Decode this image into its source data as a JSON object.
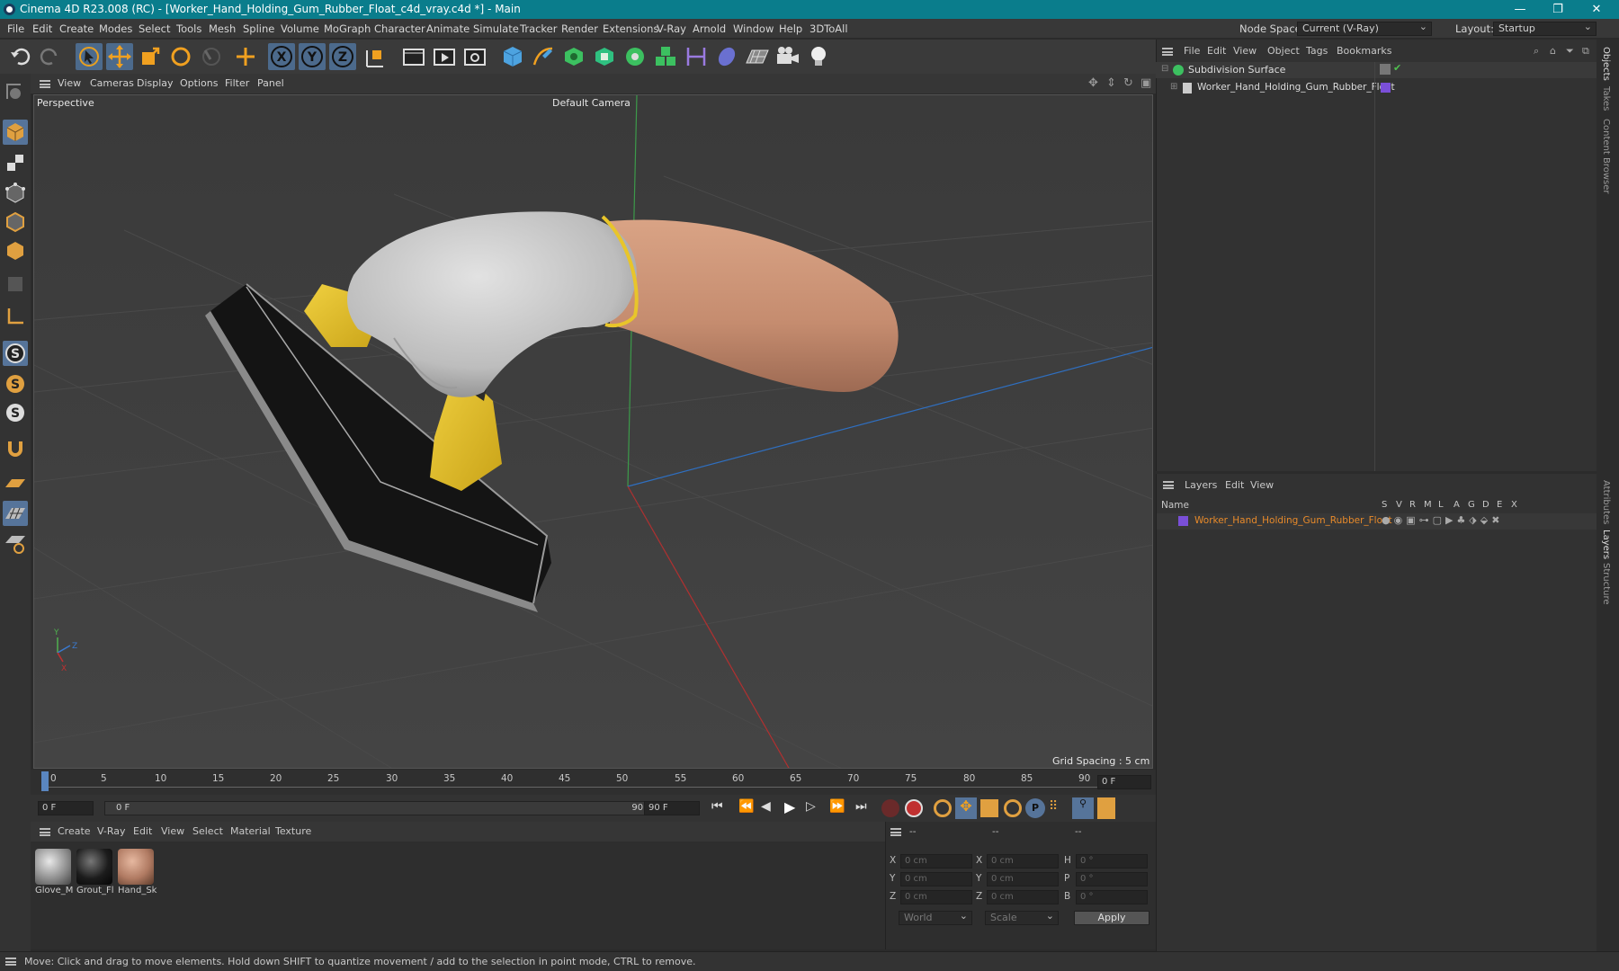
{
  "title": "Cinema 4D R23.008 (RC) - [Worker_Hand_Holding_Gum_Rubber_Float_c4d_vray.c4d *] - Main",
  "window_controls": {
    "minimize": "—",
    "restore": "❐",
    "close": "✕"
  },
  "menu": [
    "File",
    "Edit",
    "Create",
    "Modes",
    "Select",
    "Tools",
    "Mesh",
    "Spline",
    "Volume",
    "MoGraph",
    "Character",
    "Animate",
    "Simulate",
    "Tracker",
    "Render",
    "Extensions",
    "V-Ray",
    "Arnold",
    "Window",
    "Help",
    "3DToAll"
  ],
  "node_space": {
    "label": "Node Space:",
    "value": "Current (V-Ray)"
  },
  "layout": {
    "label": "Layout:",
    "value": "Startup"
  },
  "viewport": {
    "menu": [
      "View",
      "Cameras",
      "Display",
      "Options",
      "Filter",
      "Panel"
    ],
    "label": "Perspective",
    "camera": "Default Camera",
    "grid_spacing": "Grid Spacing : 5 cm",
    "axis": {
      "y": "Y",
      "z": "Z",
      "x": "X"
    }
  },
  "timeline": {
    "ticks": [
      "0",
      "5",
      "10",
      "15",
      "20",
      "25",
      "30",
      "35",
      "40",
      "45",
      "50",
      "55",
      "60",
      "65",
      "70",
      "75",
      "80",
      "85",
      "90"
    ],
    "current_frame": "0 F",
    "start": "0 F",
    "range_start": "0 F",
    "range_end": "90 F",
    "end": "90 F"
  },
  "materials": {
    "menu": [
      "Create",
      "V-Ray",
      "Edit",
      "View",
      "Select",
      "Material",
      "Texture"
    ],
    "items": [
      {
        "label": "Glove_M",
        "color": "#b9b9b9"
      },
      {
        "label": "Grout_Fl",
        "color": "#1c1c1c"
      },
      {
        "label": "Hand_Sk",
        "color": "#b07a62"
      }
    ]
  },
  "coordinates": {
    "headers": [
      "--",
      "--",
      "--"
    ],
    "rows": [
      {
        "l1": "X",
        "v1": "0 cm",
        "l2": "X",
        "v2": "0 cm",
        "l3": "H",
        "v3": "0 °"
      },
      {
        "l1": "Y",
        "v1": "0 cm",
        "l2": "Y",
        "v2": "0 cm",
        "l3": "P",
        "v3": "0 °"
      },
      {
        "l1": "Z",
        "v1": "0 cm",
        "l2": "Z",
        "v2": "0 cm",
        "l3": "B",
        "v3": "0 °"
      }
    ],
    "mode1": "World",
    "mode2": "Scale",
    "apply": "Apply"
  },
  "objects": {
    "menu": [
      "File",
      "Edit",
      "View",
      "Object",
      "Tags",
      "Bookmarks"
    ],
    "items": [
      {
        "name": "Subdivision Surface"
      },
      {
        "name": "Worker_Hand_Holding_Gum_Rubber_Float"
      }
    ]
  },
  "layers": {
    "menu": [
      "Layers",
      "Edit",
      "View"
    ],
    "col_name": "Name",
    "cols": [
      "S",
      "V",
      "R",
      "M",
      "L",
      "A",
      "G",
      "D",
      "E",
      "X"
    ],
    "items": [
      {
        "name": "Worker_Hand_Holding_Gum_Rubber_Float",
        "color": "#7a4fd8"
      }
    ]
  },
  "side_tabs": [
    "Objects",
    "Takes",
    "Content Browser",
    "Attributes",
    "Layers",
    "Structure"
  ],
  "status": "Move: Click and drag to move elements. Hold down SHIFT to quantize movement / add to the selection in point mode, CTRL to remove.",
  "colors": {
    "titlebar": "#0a7d8c",
    "accent": "#56749a",
    "layer_orange": "#e88a2a"
  }
}
